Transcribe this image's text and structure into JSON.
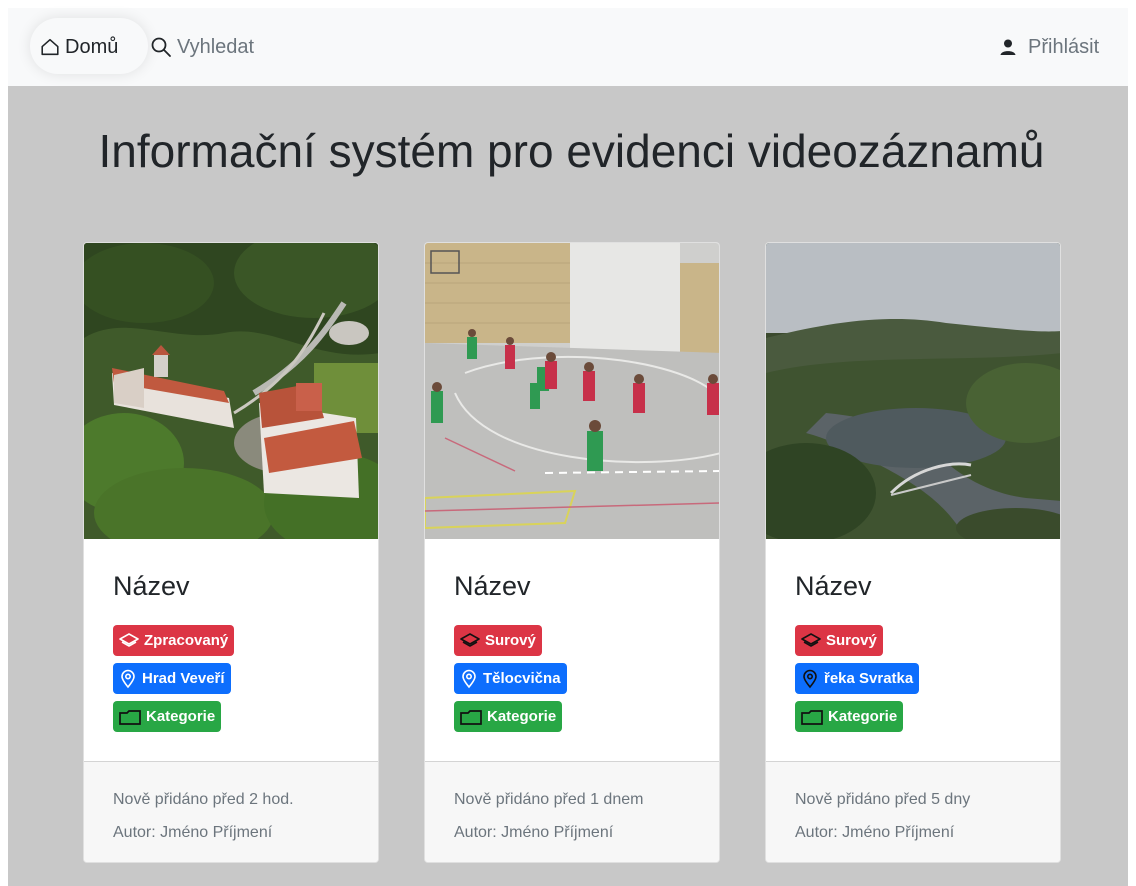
{
  "nav": {
    "home_label": "Domů",
    "search_label": "Vyhledat",
    "login_label": "Přihlásit"
  },
  "title": "Informační systém pro evidenci videozáznamů",
  "cards": [
    {
      "image": "castle-aerial",
      "title": "Název",
      "state_badge": "Zpracovaný",
      "location_badge": "Hrad Veveří",
      "category_badge": "Kategorie",
      "added": "Nově přidáno před 2 hod.",
      "author": "Autor: Jméno Příjmení"
    },
    {
      "image": "gym-handball",
      "title": "Název",
      "state_badge": "Surový",
      "location_badge": "Tělocvična",
      "category_badge": "Kategorie",
      "added": "Nově přidáno před 1 dnem",
      "author": "Autor: Jméno Příjmení"
    },
    {
      "image": "river-valley",
      "title": "Název",
      "state_badge": "Surový",
      "location_badge": "řeka Svratka",
      "category_badge": "Kategorie",
      "added": "Nově přidáno před 5 dny",
      "author": "Autor: Jméno Příjmení"
    }
  ],
  "colors": {
    "badge_state": "#dc3545",
    "badge_location": "#0d6efd",
    "badge_category": "#28a745",
    "background": "#c8c8c8",
    "navbar": "#f8f9fa"
  },
  "icons": {
    "home": "house-icon",
    "search": "magnifier-icon",
    "login": "person-icon",
    "state": "layers-icon",
    "location": "geo-pin-icon",
    "category": "folder-icon"
  }
}
